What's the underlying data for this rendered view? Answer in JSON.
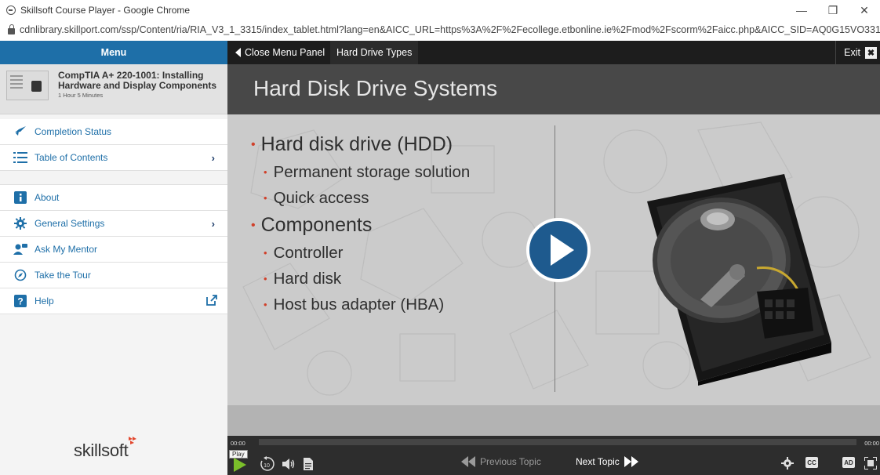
{
  "browser": {
    "window_title": "Skillsoft Course Player - Google Chrome",
    "minimize": "—",
    "restore": "❐",
    "close": "✕",
    "url": "cdnlibrary.skillport.com/ssp/Content/ria/RIA_V3_1_3315/index_tablet.html?lang=en&AICC_URL=https%3A%2F%2Fecollege.etbonline.ie%2Fmod%2Fscorm%2Faicc.php&AICC_SID=AQ0G15VO331GkbozgBYA&CBT..."
  },
  "topbar": {
    "menu_label": "Menu",
    "close_menu_label": "Close Menu Panel",
    "topic_label": "Hard Drive Types",
    "exit_label": "Exit",
    "exit_icon": "✖"
  },
  "course": {
    "title": "CompTIA A+ 220-1001: Installing Hardware and Display Components",
    "duration": "1 Hour 5 Minutes"
  },
  "menu": {
    "items": [
      {
        "label": "Completion Status",
        "icon": "completion-icon"
      },
      {
        "label": "Table of Contents",
        "icon": "list-icon",
        "chevron": "›"
      },
      {
        "label": "About",
        "icon": "info-icon"
      },
      {
        "label": "General Settings",
        "icon": "gear-icon",
        "chevron": "›"
      },
      {
        "label": "Ask My Mentor",
        "icon": "mentor-icon"
      },
      {
        "label": "Take the Tour",
        "icon": "compass-icon"
      },
      {
        "label": "Help",
        "icon": "help-icon"
      }
    ]
  },
  "brand": {
    "logo_text": "skillsoft"
  },
  "slide": {
    "title": "Hard Disk Drive Systems",
    "bullets": [
      {
        "level": 1,
        "text": "Hard disk drive (HDD)"
      },
      {
        "level": 2,
        "text": "Permanent storage solution"
      },
      {
        "level": 2,
        "text": "Quick access"
      },
      {
        "level": 1,
        "text": "Components"
      },
      {
        "level": 2,
        "text": "Controller"
      },
      {
        "level": 2,
        "text": "Hard disk"
      },
      {
        "level": 2,
        "text": "Host bus adapter (HBA)"
      }
    ]
  },
  "player": {
    "time_current": "00:00",
    "time_total": "00:00",
    "progress_fraction": 0,
    "play_tooltip": "Play",
    "replay_label": "10",
    "prev_topic": "Previous Topic",
    "next_topic": "Next Topic",
    "cc_label": "CC",
    "ad_label": "AD"
  },
  "colors": {
    "accent_blue": "#1e6fa8",
    "play_green": "#7bbf2a",
    "bullet_red": "#d0402a",
    "logo_red": "#e2462d"
  }
}
